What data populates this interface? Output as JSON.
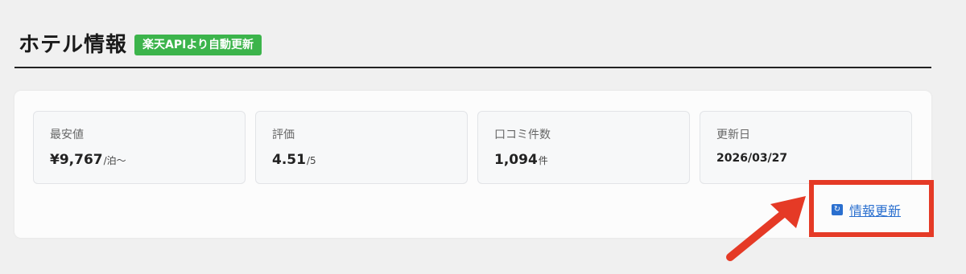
{
  "header": {
    "title": "ホテル情報",
    "badge": "楽天APIより自動更新"
  },
  "stats": [
    {
      "label": "最安値",
      "value": "¥9,767",
      "unit": "/泊〜"
    },
    {
      "label": "評価",
      "value": "4.51",
      "unit": "/5"
    },
    {
      "label": "口コミ件数",
      "value": "1,094",
      "unit": "件"
    },
    {
      "label": "更新日",
      "value": "2026/03/27"
    }
  ],
  "refresh": {
    "label": "情報更新",
    "icon": "refresh-icon"
  },
  "colors": {
    "badge_bg": "#3cb44b",
    "link": "#2a6fcf",
    "highlight": "#e53a26"
  }
}
